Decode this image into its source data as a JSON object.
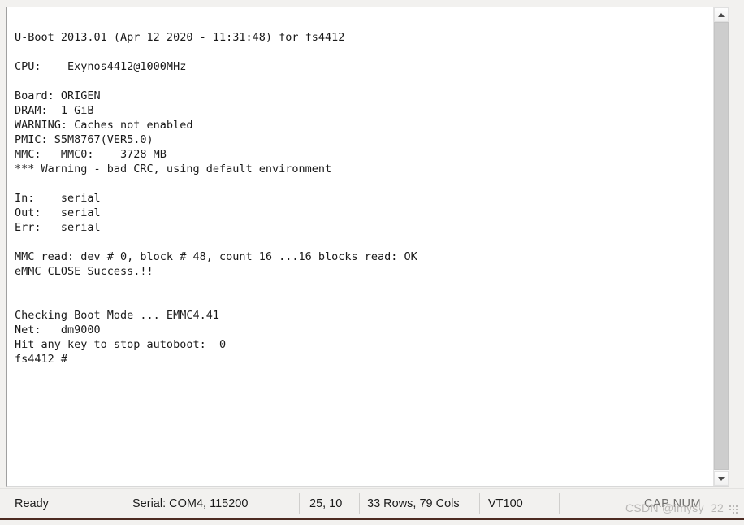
{
  "terminal": {
    "lines": [
      "U-Boot 2013.01 (Apr 12 2020 - 11:31:48) for fs4412",
      "",
      "CPU:    Exynos4412@1000MHz",
      "",
      "Board: ORIGEN",
      "DRAM:  1 GiB",
      "WARNING: Caches not enabled",
      "PMIC: S5M8767(VER5.0)",
      "MMC:   MMC0:    3728 MB",
      "*** Warning - bad CRC, using default environment",
      "",
      "In:    serial",
      "Out:   serial",
      "Err:   serial",
      "",
      "MMC read: dev # 0, block # 48, count 16 ...16 blocks read: OK",
      "eMMC CLOSE Success.!!",
      "",
      "",
      "Checking Boot Mode ... EMMC4.41",
      "Net:   dm9000",
      "Hit any key to stop autoboot:  0",
      "fs4412 #"
    ]
  },
  "scrollbar": {
    "up_icon": "chevron-up-icon",
    "down_icon": "chevron-down-icon"
  },
  "status_bar": {
    "ready": "Ready",
    "serial": "Serial: COM4, 115200",
    "coords": "25, 10",
    "dimensions": "33 Rows, 79 Cols",
    "terminal_type": "VT100",
    "caps_num": "CAP NUM"
  },
  "watermark": {
    "text": "CSDN @imysy_22"
  },
  "colors": {
    "terminal_bg": "#ffffff",
    "terminal_text": "#1a1a1a",
    "chrome_bg": "#f2f1ef",
    "scrollbar_thumb": "#cdcdcd",
    "bottom_rule": "#4d2b22"
  }
}
